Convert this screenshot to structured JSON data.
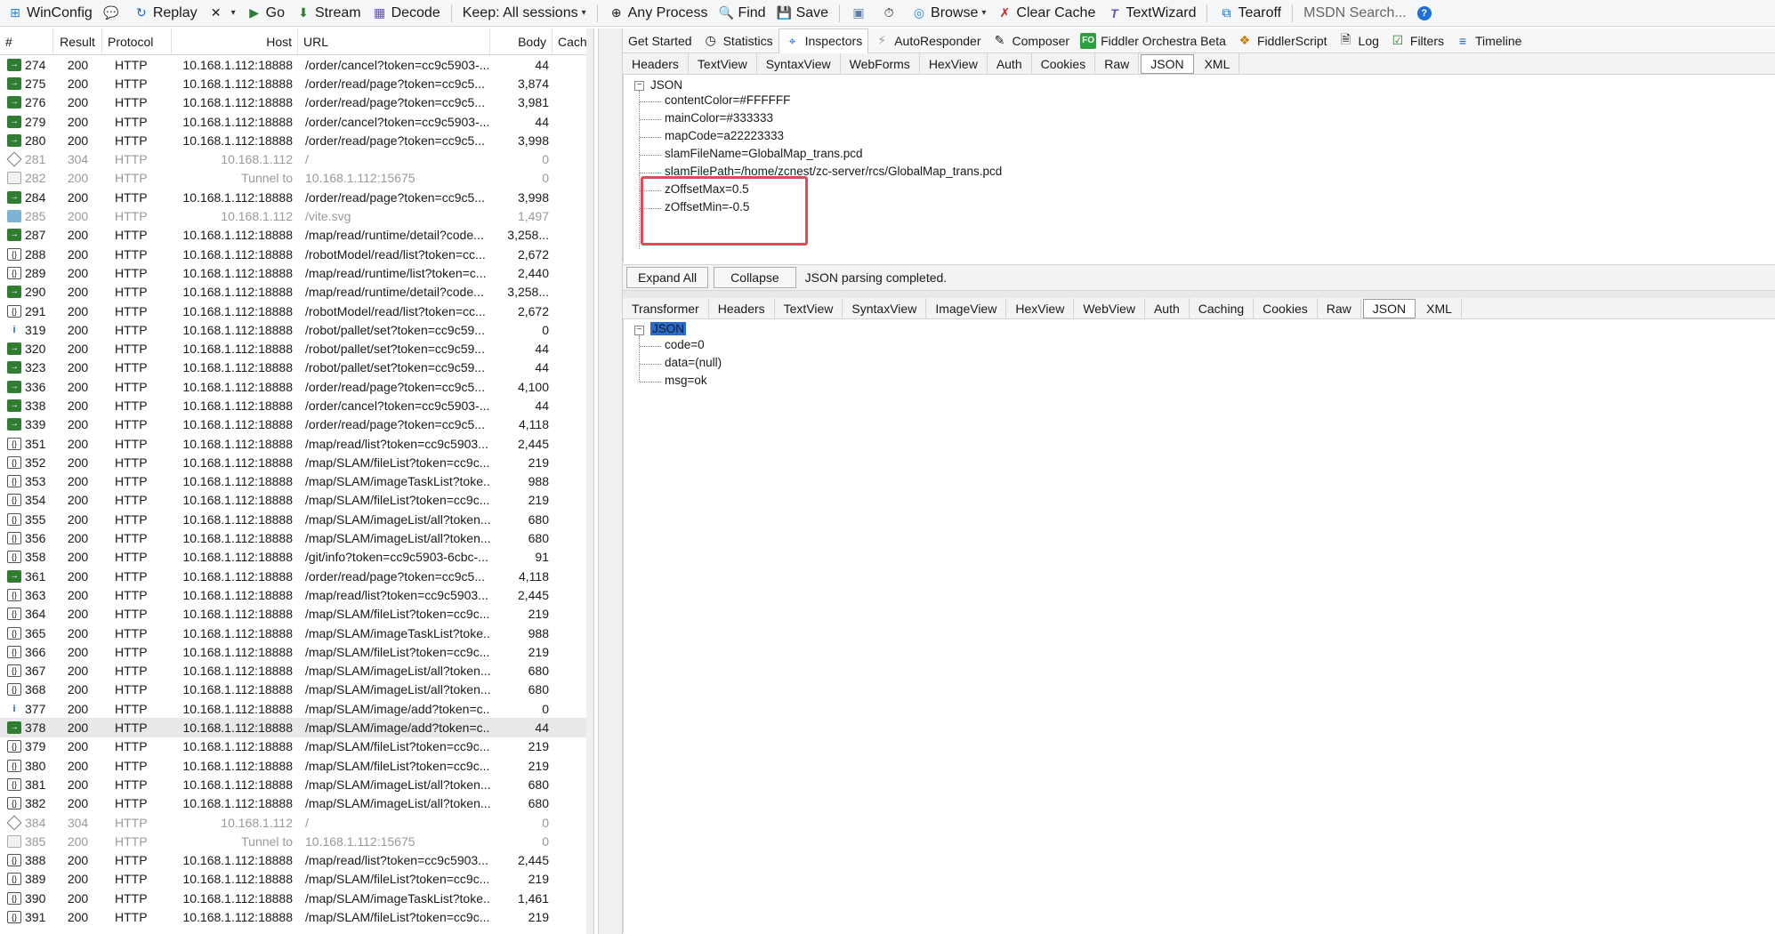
{
  "toolbar": {
    "items": [
      {
        "label": "WinConfig",
        "icon": "windows-icon"
      },
      {
        "label": "",
        "icon": "comment-icon"
      },
      {
        "label": "Replay",
        "icon": "replay-icon"
      },
      {
        "label": "",
        "icon": "remove-icon"
      },
      {
        "label": "Go",
        "icon": "go-icon"
      },
      {
        "label": "Stream",
        "icon": "stream-icon"
      },
      {
        "label": "Decode",
        "icon": "decode-icon"
      },
      {
        "label": "Keep: All sessions",
        "icon": ""
      },
      {
        "label": "Any Process",
        "icon": "crosshair-icon"
      },
      {
        "label": "Find",
        "icon": "find-icon"
      },
      {
        "label": "Save",
        "icon": "save-icon"
      },
      {
        "label": "",
        "icon": "screenshot-icon"
      },
      {
        "label": "",
        "icon": "timer-icon"
      },
      {
        "label": "Browse",
        "icon": "browser-icon"
      },
      {
        "label": "Clear Cache",
        "icon": "clear-cache-icon"
      },
      {
        "label": "TextWizard",
        "icon": "textwizard-icon"
      },
      {
        "label": "Tearoff",
        "icon": "tearoff-icon"
      },
      {
        "label": "MSDN Search...",
        "icon": ""
      },
      {
        "label": "",
        "icon": "help-icon"
      }
    ]
  },
  "sessions": {
    "columns": [
      "#",
      "Result",
      "Protocol",
      "Host",
      "URL",
      "Body",
      "Cachi"
    ],
    "rows": [
      {
        "num": "274",
        "result": "200",
        "proto": "HTTP",
        "host": "10.168.1.112:18888",
        "url": "/order/cancel?token=cc9c5903-...",
        "body": "44",
        "icon": "get"
      },
      {
        "num": "275",
        "result": "200",
        "proto": "HTTP",
        "host": "10.168.1.112:18888",
        "url": "/order/read/page?token=cc9c5...",
        "body": "3,874",
        "icon": "get"
      },
      {
        "num": "276",
        "result": "200",
        "proto": "HTTP",
        "host": "10.168.1.112:18888",
        "url": "/order/read/page?token=cc9c5...",
        "body": "3,981",
        "icon": "get"
      },
      {
        "num": "279",
        "result": "200",
        "proto": "HTTP",
        "host": "10.168.1.112:18888",
        "url": "/order/cancel?token=cc9c5903-...",
        "body": "44",
        "icon": "get"
      },
      {
        "num": "280",
        "result": "200",
        "proto": "HTTP",
        "host": "10.168.1.112:18888",
        "url": "/order/read/page?token=cc9c5...",
        "body": "3,998",
        "icon": "get"
      },
      {
        "num": "281",
        "result": "304",
        "proto": "HTTP",
        "host": "10.168.1.112",
        "url": "/",
        "body": "0",
        "icon": "diamond",
        "dim": true
      },
      {
        "num": "282",
        "result": "200",
        "proto": "HTTP",
        "host": "Tunnel to",
        "url": "10.168.1.112:15675",
        "body": "0",
        "icon": "tunnel",
        "dim": true
      },
      {
        "num": "284",
        "result": "200",
        "proto": "HTTP",
        "host": "10.168.1.112:18888",
        "url": "/order/read/page?token=cc9c5...",
        "body": "3,998",
        "icon": "get"
      },
      {
        "num": "285",
        "result": "200",
        "proto": "HTTP",
        "host": "10.168.1.112",
        "url": "/vite.svg",
        "body": "1,497",
        "icon": "img",
        "dim": true
      },
      {
        "num": "287",
        "result": "200",
        "proto": "HTTP",
        "host": "10.168.1.112:18888",
        "url": "/map/read/runtime/detail?code...",
        "body": "3,258...",
        "icon": "get"
      },
      {
        "num": "288",
        "result": "200",
        "proto": "HTTP",
        "host": "10.168.1.112:18888",
        "url": "/robotModel/read/list?token=cc...",
        "body": "2,672",
        "icon": "json"
      },
      {
        "num": "289",
        "result": "200",
        "proto": "HTTP",
        "host": "10.168.1.112:18888",
        "url": "/map/read/runtime/list?token=c...",
        "body": "2,440",
        "icon": "json"
      },
      {
        "num": "290",
        "result": "200",
        "proto": "HTTP",
        "host": "10.168.1.112:18888",
        "url": "/map/read/runtime/detail?code...",
        "body": "3,258...",
        "icon": "get"
      },
      {
        "num": "291",
        "result": "200",
        "proto": "HTTP",
        "host": "10.168.1.112:18888",
        "url": "/robotModel/read/list?token=cc...",
        "body": "2,672",
        "icon": "json"
      },
      {
        "num": "319",
        "result": "200",
        "proto": "HTTP",
        "host": "10.168.1.112:18888",
        "url": "/robot/pallet/set?token=cc9c59...",
        "body": "0",
        "icon": "info"
      },
      {
        "num": "320",
        "result": "200",
        "proto": "HTTP",
        "host": "10.168.1.112:18888",
        "url": "/robot/pallet/set?token=cc9c59...",
        "body": "44",
        "icon": "get"
      },
      {
        "num": "323",
        "result": "200",
        "proto": "HTTP",
        "host": "10.168.1.112:18888",
        "url": "/robot/pallet/set?token=cc9c59...",
        "body": "44",
        "icon": "get"
      },
      {
        "num": "336",
        "result": "200",
        "proto": "HTTP",
        "host": "10.168.1.112:18888",
        "url": "/order/read/page?token=cc9c5...",
        "body": "4,100",
        "icon": "get"
      },
      {
        "num": "338",
        "result": "200",
        "proto": "HTTP",
        "host": "10.168.1.112:18888",
        "url": "/order/cancel?token=cc9c5903-...",
        "body": "44",
        "icon": "get"
      },
      {
        "num": "339",
        "result": "200",
        "proto": "HTTP",
        "host": "10.168.1.112:18888",
        "url": "/order/read/page?token=cc9c5...",
        "body": "4,118",
        "icon": "get"
      },
      {
        "num": "351",
        "result": "200",
        "proto": "HTTP",
        "host": "10.168.1.112:18888",
        "url": "/map/read/list?token=cc9c5903...",
        "body": "2,445",
        "icon": "json"
      },
      {
        "num": "352",
        "result": "200",
        "proto": "HTTP",
        "host": "10.168.1.112:18888",
        "url": "/map/SLAM/fileList?token=cc9c...",
        "body": "219",
        "icon": "json"
      },
      {
        "num": "353",
        "result": "200",
        "proto": "HTTP",
        "host": "10.168.1.112:18888",
        "url": "/map/SLAM/imageTaskList?toke...",
        "body": "988",
        "icon": "json"
      },
      {
        "num": "354",
        "result": "200",
        "proto": "HTTP",
        "host": "10.168.1.112:18888",
        "url": "/map/SLAM/fileList?token=cc9c...",
        "body": "219",
        "icon": "json"
      },
      {
        "num": "355",
        "result": "200",
        "proto": "HTTP",
        "host": "10.168.1.112:18888",
        "url": "/map/SLAM/imageList/all?token...",
        "body": "680",
        "icon": "json"
      },
      {
        "num": "356",
        "result": "200",
        "proto": "HTTP",
        "host": "10.168.1.112:18888",
        "url": "/map/SLAM/imageList/all?token...",
        "body": "680",
        "icon": "json"
      },
      {
        "num": "358",
        "result": "200",
        "proto": "HTTP",
        "host": "10.168.1.112:18888",
        "url": "/git/info?token=cc9c5903-6cbc-...",
        "body": "91",
        "icon": "json"
      },
      {
        "num": "361",
        "result": "200",
        "proto": "HTTP",
        "host": "10.168.1.112:18888",
        "url": "/order/read/page?token=cc9c5...",
        "body": "4,118",
        "icon": "get"
      },
      {
        "num": "363",
        "result": "200",
        "proto": "HTTP",
        "host": "10.168.1.112:18888",
        "url": "/map/read/list?token=cc9c5903...",
        "body": "2,445",
        "icon": "json"
      },
      {
        "num": "364",
        "result": "200",
        "proto": "HTTP",
        "host": "10.168.1.112:18888",
        "url": "/map/SLAM/fileList?token=cc9c...",
        "body": "219",
        "icon": "json"
      },
      {
        "num": "365",
        "result": "200",
        "proto": "HTTP",
        "host": "10.168.1.112:18888",
        "url": "/map/SLAM/imageTaskList?toke...",
        "body": "988",
        "icon": "json"
      },
      {
        "num": "366",
        "result": "200",
        "proto": "HTTP",
        "host": "10.168.1.112:18888",
        "url": "/map/SLAM/fileList?token=cc9c...",
        "body": "219",
        "icon": "json"
      },
      {
        "num": "367",
        "result": "200",
        "proto": "HTTP",
        "host": "10.168.1.112:18888",
        "url": "/map/SLAM/imageList/all?token...",
        "body": "680",
        "icon": "json"
      },
      {
        "num": "368",
        "result": "200",
        "proto": "HTTP",
        "host": "10.168.1.112:18888",
        "url": "/map/SLAM/imageList/all?token...",
        "body": "680",
        "icon": "json"
      },
      {
        "num": "377",
        "result": "200",
        "proto": "HTTP",
        "host": "10.168.1.112:18888",
        "url": "/map/SLAM/image/add?token=c...",
        "body": "0",
        "icon": "info"
      },
      {
        "num": "378",
        "result": "200",
        "proto": "HTTP",
        "host": "10.168.1.112:18888",
        "url": "/map/SLAM/image/add?token=c...",
        "body": "44",
        "icon": "get",
        "selected": true
      },
      {
        "num": "379",
        "result": "200",
        "proto": "HTTP",
        "host": "10.168.1.112:18888",
        "url": "/map/SLAM/fileList?token=cc9c...",
        "body": "219",
        "icon": "json"
      },
      {
        "num": "380",
        "result": "200",
        "proto": "HTTP",
        "host": "10.168.1.112:18888",
        "url": "/map/SLAM/fileList?token=cc9c...",
        "body": "219",
        "icon": "json"
      },
      {
        "num": "381",
        "result": "200",
        "proto": "HTTP",
        "host": "10.168.1.112:18888",
        "url": "/map/SLAM/imageList/all?token...",
        "body": "680",
        "icon": "json"
      },
      {
        "num": "382",
        "result": "200",
        "proto": "HTTP",
        "host": "10.168.1.112:18888",
        "url": "/map/SLAM/imageList/all?token...",
        "body": "680",
        "icon": "json"
      },
      {
        "num": "384",
        "result": "304",
        "proto": "HTTP",
        "host": "10.168.1.112",
        "url": "/",
        "body": "0",
        "icon": "diamond",
        "dim": true
      },
      {
        "num": "385",
        "result": "200",
        "proto": "HTTP",
        "host": "Tunnel to",
        "url": "10.168.1.112:15675",
        "body": "0",
        "icon": "tunnel",
        "dim": true
      },
      {
        "num": "388",
        "result": "200",
        "proto": "HTTP",
        "host": "10.168.1.112:18888",
        "url": "/map/read/list?token=cc9c5903...",
        "body": "2,445",
        "icon": "json"
      },
      {
        "num": "389",
        "result": "200",
        "proto": "HTTP",
        "host": "10.168.1.112:18888",
        "url": "/map/SLAM/fileList?token=cc9c...",
        "body": "219",
        "icon": "json"
      },
      {
        "num": "390",
        "result": "200",
        "proto": "HTTP",
        "host": "10.168.1.112:18888",
        "url": "/map/SLAM/imageTaskList?toke...",
        "body": "1,461",
        "icon": "json"
      },
      {
        "num": "391",
        "result": "200",
        "proto": "HTTP",
        "host": "10.168.1.112:18888",
        "url": "/map/SLAM/fileList?token=cc9c...",
        "body": "219",
        "icon": "json"
      }
    ]
  },
  "main_tabs": [
    {
      "label": "Get Started",
      "icon": ""
    },
    {
      "label": "Statistics",
      "icon": "statistics-icon"
    },
    {
      "label": "Inspectors",
      "icon": "inspectors-icon",
      "active": true
    },
    {
      "label": "AutoResponder",
      "icon": "autoresponder-icon"
    },
    {
      "label": "Composer",
      "icon": "composer-icon"
    },
    {
      "label": "Fiddler Orchestra Beta",
      "icon": "orchestra-icon",
      "badge": "FO"
    },
    {
      "label": "FiddlerScript",
      "icon": "fiddlerscript-icon"
    },
    {
      "label": "Log",
      "icon": "log-icon"
    },
    {
      "label": "Filters",
      "icon": "filters-icon"
    },
    {
      "label": "Timeline",
      "icon": "timeline-icon"
    }
  ],
  "request_tabs": [
    "Headers",
    "TextView",
    "SyntaxView",
    "WebForms",
    "HexView",
    "Auth",
    "Cookies",
    "Raw",
    "JSON",
    "XML"
  ],
  "request_active_tab": "JSON",
  "request_tree": {
    "root": "JSON",
    "items": [
      "contentColor=#FFFFFF",
      "mainColor=#333333",
      "mapCode=a22223333",
      "slamFileName=GlobalMap_trans.pcd",
      "slamFilePath=/home/zcnest/zc-server/rcs/GlobalMap_trans.pcd",
      "zOffsetMax=0.5",
      "zOffsetMin=-0.5"
    ],
    "highlight_color": "#E04B5A"
  },
  "request_bar": {
    "expand_all": "Expand All",
    "collapse": "Collapse",
    "status": "JSON parsing completed."
  },
  "response_tabs": [
    "Transformer",
    "Headers",
    "TextView",
    "SyntaxView",
    "ImageView",
    "HexView",
    "WebView",
    "Auth",
    "Caching",
    "Cookies",
    "Raw",
    "JSON",
    "XML"
  ],
  "response_active_tab": "JSON",
  "response_tree": {
    "root": "JSON",
    "items": [
      "code=0",
      "data=(null)",
      "msg=ok"
    ]
  }
}
